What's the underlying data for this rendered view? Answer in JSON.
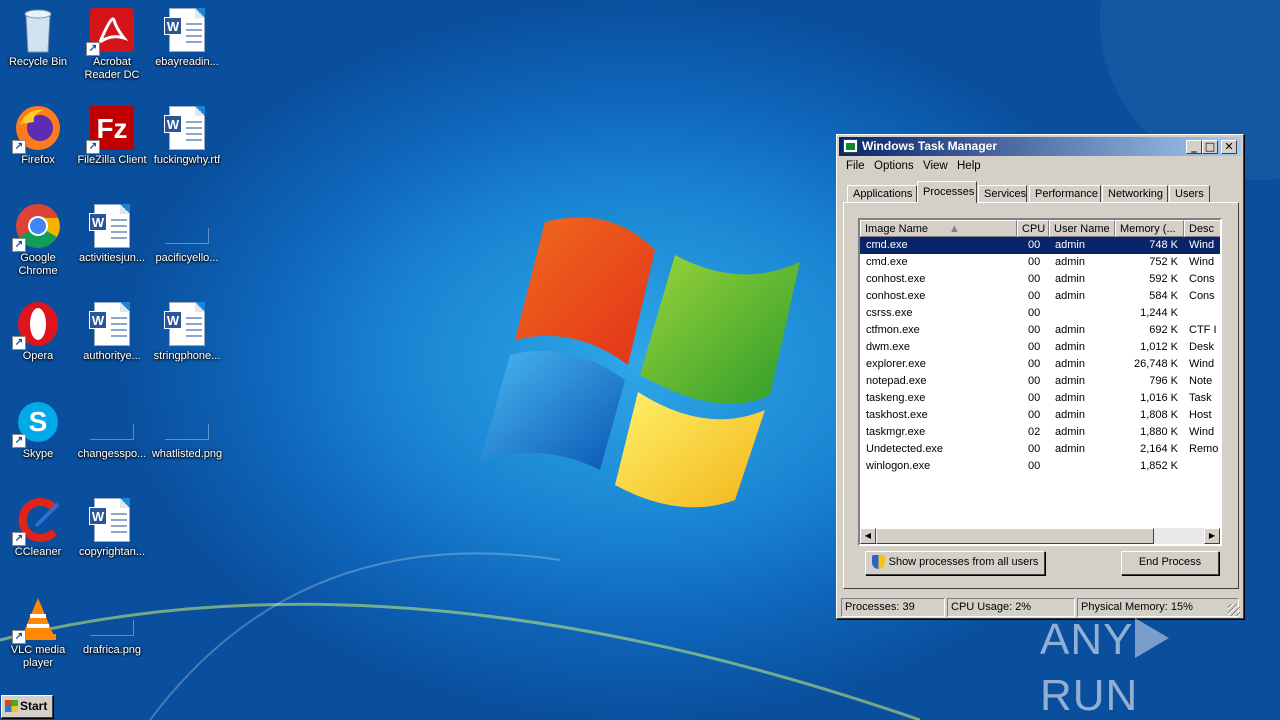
{
  "desktop": {
    "icons": [
      {
        "label": "Recycle Bin",
        "icon": "recycle-bin-icon"
      },
      {
        "label": "Acrobat Reader DC",
        "icon": "acrobat-reader-icon"
      },
      {
        "label": "ebayreadin...",
        "icon": "word-document-icon"
      },
      {
        "label": "Firefox",
        "icon": "firefox-icon"
      },
      {
        "label": "FileZilla Client",
        "icon": "filezilla-icon"
      },
      {
        "label": "fuckingwhy.rtf",
        "icon": "word-document-icon"
      },
      {
        "label": "Google Chrome",
        "icon": "chrome-icon"
      },
      {
        "label": "activitiesjun...",
        "icon": "word-document-icon"
      },
      {
        "label": "pacificyello...",
        "icon": "image-file-icon"
      },
      {
        "label": "Opera",
        "icon": "opera-icon"
      },
      {
        "label": "authorityе...",
        "icon": "word-document-icon"
      },
      {
        "label": "stringphone...",
        "icon": "word-document-icon"
      },
      {
        "label": "Skype",
        "icon": "skype-icon"
      },
      {
        "label": "changesspo...",
        "icon": "image-file-icon"
      },
      {
        "label": "whatlisted.png",
        "icon": "image-file-icon"
      },
      {
        "label": "CCleaner",
        "icon": "ccleaner-icon"
      },
      {
        "label": "copyrightan...",
        "icon": "word-document-icon"
      },
      {
        "label": "VLC media player",
        "icon": "vlc-icon"
      },
      {
        "label": "drafrica.png",
        "icon": "image-file-icon"
      }
    ]
  },
  "task_manager": {
    "title": "Windows Task Manager",
    "window_buttons": {
      "minimize": "_",
      "maximize": "□",
      "close": "✕"
    },
    "menu": [
      "File",
      "Options",
      "View",
      "Help"
    ],
    "tabs": [
      "Applications",
      "Processes",
      "Services",
      "Performance",
      "Networking",
      "Users"
    ],
    "active_tab": "Processes",
    "columns": [
      "Image Name",
      "CPU",
      "User Name",
      "Memory (...",
      "Desc"
    ],
    "sort_indicator": "▲",
    "processes": [
      {
        "name": "cmd.exe",
        "cpu": "00",
        "user": "admin",
        "memory": "748 K",
        "desc": "Wind"
      },
      {
        "name": "cmd.exe",
        "cpu": "00",
        "user": "admin",
        "memory": "752 K",
        "desc": "Wind"
      },
      {
        "name": "conhost.exe",
        "cpu": "00",
        "user": "admin",
        "memory": "592 K",
        "desc": "Cons"
      },
      {
        "name": "conhost.exe",
        "cpu": "00",
        "user": "admin",
        "memory": "584 K",
        "desc": "Cons"
      },
      {
        "name": "csrss.exe",
        "cpu": "00",
        "user": "",
        "memory": "1,244 K",
        "desc": ""
      },
      {
        "name": "ctfmon.exe",
        "cpu": "00",
        "user": "admin",
        "memory": "692 K",
        "desc": "CTF I"
      },
      {
        "name": "dwm.exe",
        "cpu": "00",
        "user": "admin",
        "memory": "1,012 K",
        "desc": "Desk"
      },
      {
        "name": "explorer.exe",
        "cpu": "00",
        "user": "admin",
        "memory": "26,748 K",
        "desc": "Wind"
      },
      {
        "name": "notepad.exe",
        "cpu": "00",
        "user": "admin",
        "memory": "796 K",
        "desc": "Note"
      },
      {
        "name": "taskeng.exe",
        "cpu": "00",
        "user": "admin",
        "memory": "1,016 K",
        "desc": "Task"
      },
      {
        "name": "taskhost.exe",
        "cpu": "00",
        "user": "admin",
        "memory": "1,808 K",
        "desc": "Host"
      },
      {
        "name": "taskmgr.exe",
        "cpu": "02",
        "user": "admin",
        "memory": "1,880 K",
        "desc": "Wind"
      },
      {
        "name": "Undetected.exe",
        "cpu": "00",
        "user": "admin",
        "memory": "2,164 K",
        "desc": "Remo"
      },
      {
        "name": "winlogon.exe",
        "cpu": "00",
        "user": "",
        "memory": "1,852 K",
        "desc": ""
      }
    ],
    "show_all_button": "Show processes from all users",
    "end_process_button": "End Process",
    "status": {
      "processes": "Processes: 39",
      "cpu_usage": "CPU Usage: 2%",
      "physical_memory": "Physical Memory: 15%"
    }
  },
  "taskbar": {
    "start_label": "Start"
  },
  "watermark": {
    "left": "ANY",
    "right": "RUN"
  },
  "colors": {
    "selection": "#0a246a",
    "titlebar": "#0a246a",
    "window_face": "#d4d0c8",
    "desktop": "#1a86d3"
  }
}
